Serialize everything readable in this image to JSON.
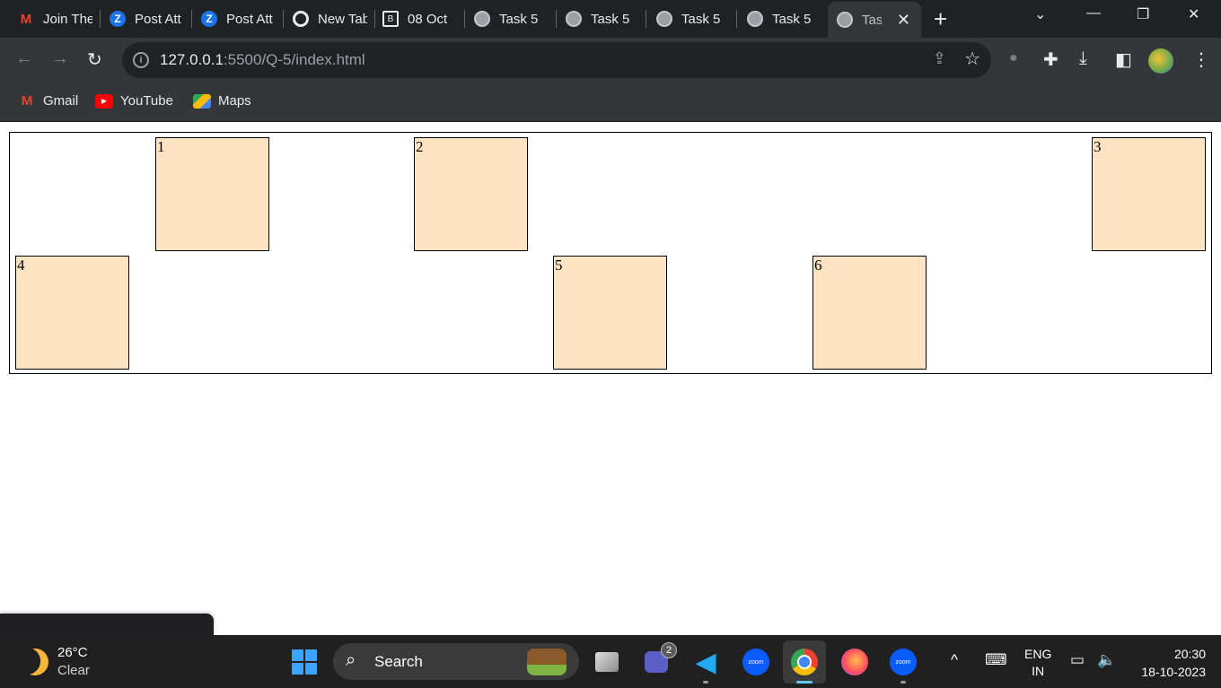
{
  "browser": {
    "tabs": [
      {
        "label": "Join The",
        "icon": "gmail-icon"
      },
      {
        "label": "Post Att",
        "icon": "zoho-icon"
      },
      {
        "label": "Post Att",
        "icon": "zoho-icon"
      },
      {
        "label": "New Tab",
        "icon": "chrome-icon"
      },
      {
        "label": "08 Oct",
        "icon": "document-icon"
      },
      {
        "label": "Task 5",
        "icon": "globe-icon"
      },
      {
        "label": "Task 5",
        "icon": "globe-icon"
      },
      {
        "label": "Task 5",
        "icon": "globe-icon"
      },
      {
        "label": "Task 5",
        "icon": "globe-icon"
      },
      {
        "label": "Task",
        "icon": "globe-icon",
        "active": true
      }
    ],
    "url_host": "127.0.0.1",
    "url_rest": ":5500/Q-5/index.html",
    "bookmarks": [
      {
        "label": "Gmail",
        "icon": "gmail-icon"
      },
      {
        "label": "YouTube",
        "icon": "youtube-icon"
      },
      {
        "label": "Maps",
        "icon": "maps-icon"
      }
    ]
  },
  "page": {
    "boxes": [
      "1",
      "2",
      "3",
      "4",
      "5",
      "6"
    ],
    "box_color": "#ffe4c4"
  },
  "taskbar": {
    "weather_temp": "26°C",
    "weather_condition": "Clear",
    "search_label": "Search",
    "teams_badge": "2",
    "zoom_label": "zoom",
    "language_line1": "ENG",
    "language_line2": "IN",
    "time": "20:30",
    "date": "18-10-2023"
  }
}
